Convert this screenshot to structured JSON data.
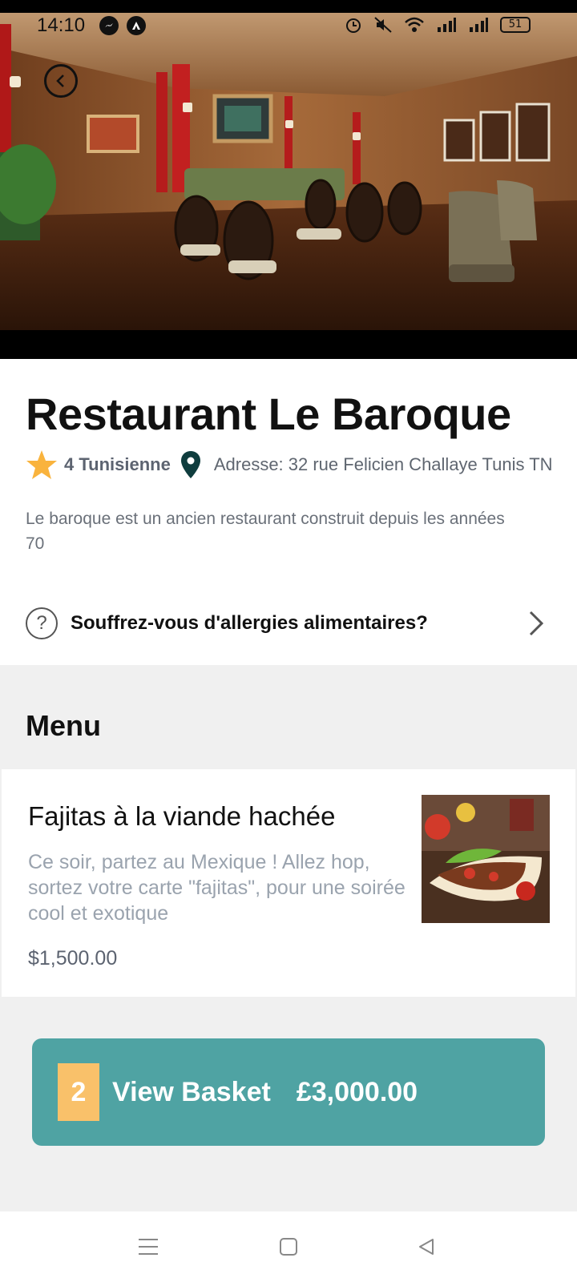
{
  "status_bar": {
    "time": "14:10",
    "left_icons": [
      "messenger-icon",
      "notification-a-icon"
    ],
    "right_icons": [
      "alarm-icon",
      "mute-icon",
      "wifi-icon",
      "signal-1-icon",
      "signal-2-icon"
    ],
    "battery": "51"
  },
  "hero": {
    "image": "restaurant-interior-photo",
    "back_icon": "back-circle-icon"
  },
  "restaurant": {
    "name": "Restaurant Le Baroque",
    "rating_icon": "star-icon",
    "rating_text": "4 Tunisienne",
    "location_icon": "map-pin-icon",
    "address": "Adresse: 32 rue Felicien Challaye Tunis TN",
    "description": "Le baroque est un ancien restaurant construit depuis les années 70",
    "allergy_prompt": "Souffrez-vous d'allergies alimentaires?"
  },
  "menu": {
    "title": "Menu",
    "items": [
      {
        "name": "Fajitas à la viande hachée",
        "description": "Ce soir, partez au Mexique ! Allez hop, sortez votre carte \"fajitas\", pour une soirée cool et exotique",
        "price": "$1,500.00",
        "image": "fajitas-photo"
      }
    ]
  },
  "basket": {
    "count": "2",
    "label": "View Basket",
    "total": "£3,000.00"
  },
  "nav_bar": {
    "buttons": [
      "menu-icon",
      "home-square-icon",
      "back-triangle-icon"
    ]
  },
  "colors": {
    "basket_bg": "#4fa3a3",
    "basket_count_bg": "#f9c16a",
    "star": "#f9b33d",
    "pin": "#0f3d3e"
  }
}
